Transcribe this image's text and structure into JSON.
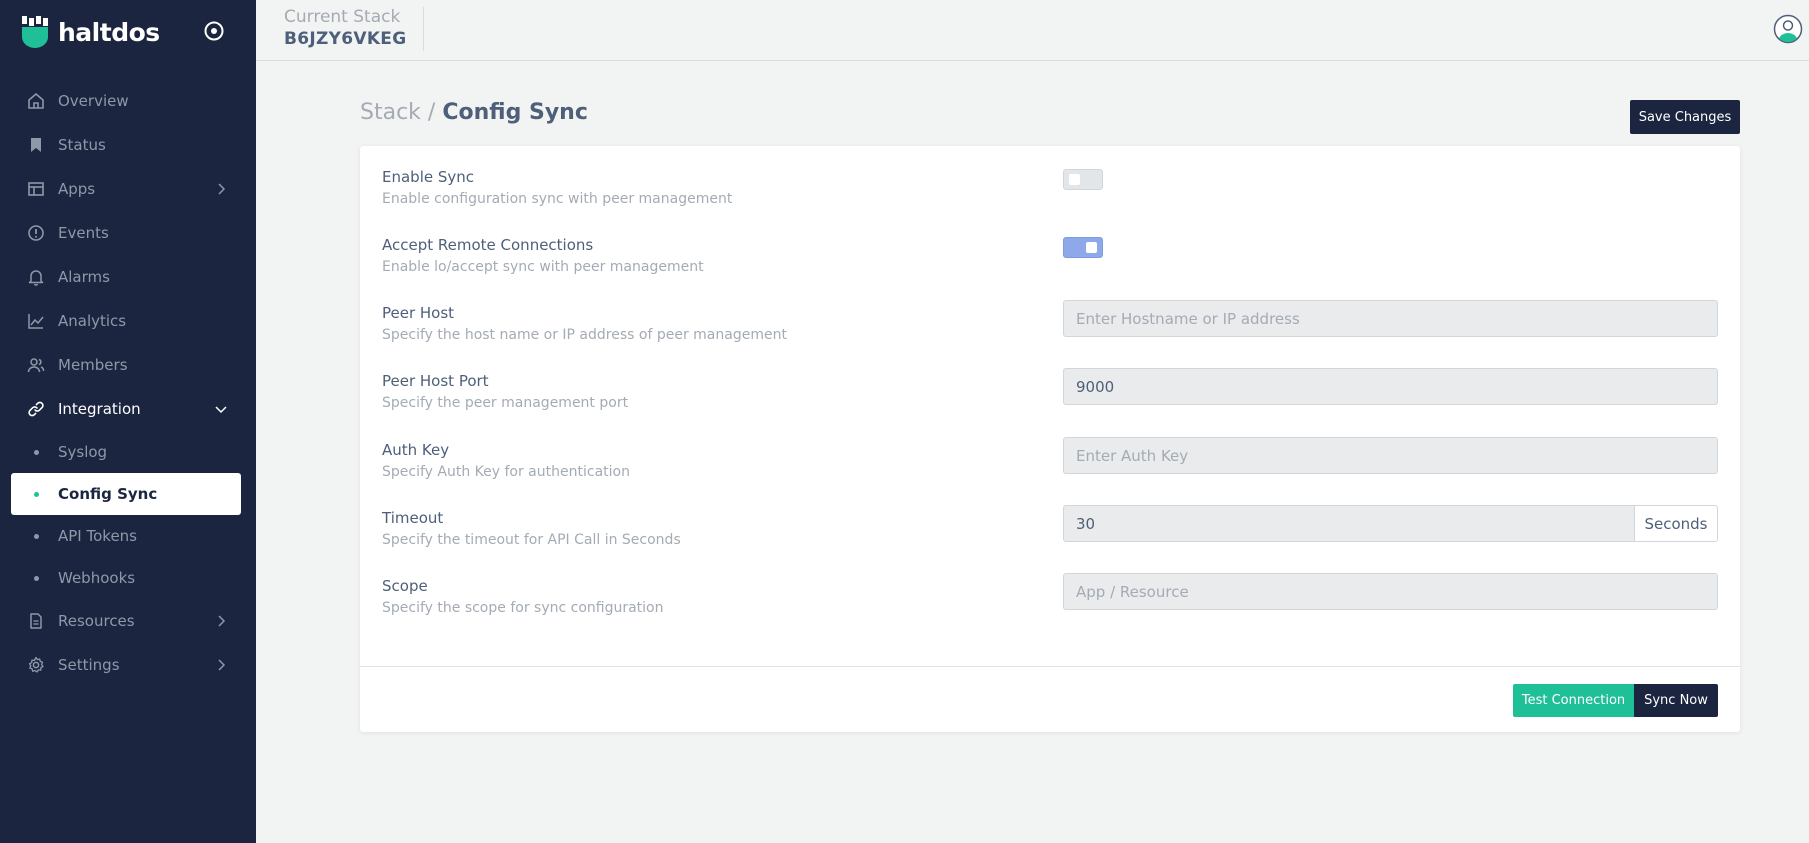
{
  "brand": {
    "name": "haltdos"
  },
  "header": {
    "stack_label": "Current Stack",
    "stack_id": "B6JZY6VKEG"
  },
  "sidebar": {
    "items": [
      {
        "label": "Overview",
        "icon": "home-icon"
      },
      {
        "label": "Status",
        "icon": "bookmark-icon"
      },
      {
        "label": "Apps",
        "icon": "layout-icon"
      },
      {
        "label": "Events",
        "icon": "alert-circle-icon"
      },
      {
        "label": "Alarms",
        "icon": "bell-icon"
      },
      {
        "label": "Analytics",
        "icon": "chart-line-icon"
      },
      {
        "label": "Members",
        "icon": "users-icon"
      },
      {
        "label": "Integration",
        "icon": "link-icon"
      },
      {
        "label": "Resources",
        "icon": "file-icon"
      },
      {
        "label": "Settings",
        "icon": "gear-icon"
      }
    ],
    "integration_sub": [
      {
        "label": "Syslog"
      },
      {
        "label": "Config Sync"
      },
      {
        "label": "API Tokens"
      },
      {
        "label": "Webhooks"
      }
    ]
  },
  "page": {
    "breadcrumb_parent": "Stack",
    "breadcrumb_sep": "/",
    "breadcrumb_current": "Config Sync",
    "save_label": "Save Changes"
  },
  "form": {
    "enable_sync": {
      "label": "Enable Sync",
      "desc": "Enable configuration sync with peer management",
      "enabled": false
    },
    "accept_remote": {
      "label": "Accept Remote Connections",
      "desc": "Enable lo/accept sync with peer management",
      "enabled": true
    },
    "peer_host": {
      "label": "Peer Host",
      "desc": "Specify the host name or IP address of peer management",
      "value": "",
      "placeholder": "Enter Hostname or IP address"
    },
    "peer_port": {
      "label": "Peer Host Port",
      "desc": "Specify the peer management port",
      "value": "9000",
      "placeholder": ""
    },
    "auth_key": {
      "label": "Auth Key",
      "desc": "Specify Auth Key for authentication",
      "value": "",
      "placeholder": "Enter Auth Key"
    },
    "timeout": {
      "label": "Timeout",
      "desc": "Specify the timeout for API Call in Seconds",
      "value": "30",
      "unit": "Seconds"
    },
    "scope": {
      "label": "Scope",
      "desc": "Specify the scope for sync configuration",
      "value": "",
      "placeholder": "App / Resource"
    }
  },
  "actions": {
    "test_label": "Test Connection",
    "sync_label": "Sync Now"
  },
  "colors": {
    "sidebar": "#1b2540",
    "accent": "#1fbf98",
    "toggle_on": "#8ea9ea"
  }
}
